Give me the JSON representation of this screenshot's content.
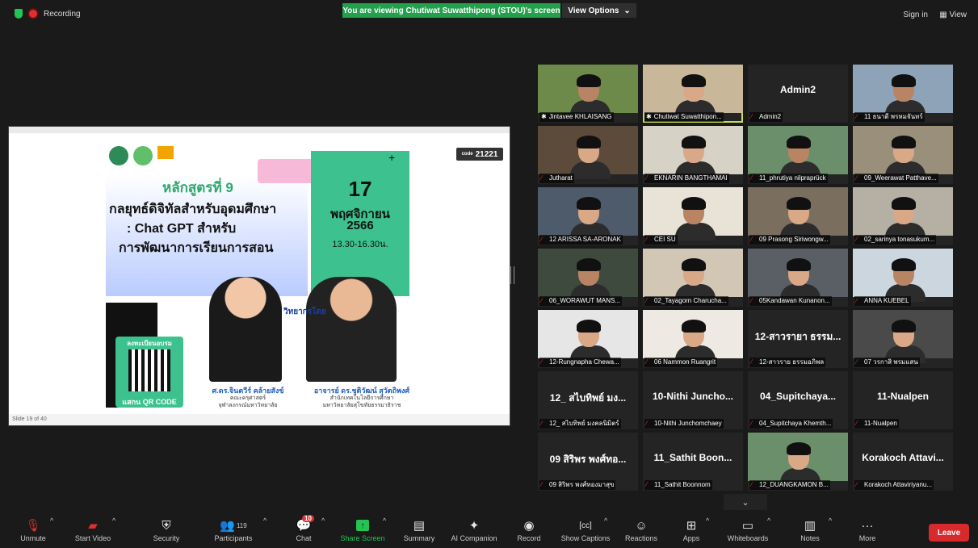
{
  "topbar": {
    "recording_label": "Recording",
    "viewing_banner": "You are viewing Chutiwat Suwatthipong (STOU)'s screen",
    "view_options": "View Options",
    "sign_in": "Sign in",
    "view": "View"
  },
  "slide": {
    "code_prefix": "code",
    "code": "21221",
    "course_title": "หลักสูตรที่ 9",
    "title_line1": "กลยุทธ์ดิจิทัลสำหรับอุดมศึกษา",
    "title_line2": ": Chat GPT สำหรับ",
    "title_line3": "การพัฒนาการเรียนการสอน",
    "day": "17",
    "month": "พฤศจิกายน",
    "year": "2566",
    "time": "13.30-16.30น.",
    "register_label": "ลงทะเบียนอบรม",
    "scan_label": "แสกน QR CODE",
    "speaker_heading": "วิทยากรโดย",
    "speaker1_name": "ศ.ดร.จินตวีร์ คล้ายสังข์",
    "speaker1_org1": "คณะครุศาสตร์",
    "speaker1_org2": "จุฬาลงกรณ์มหาวิทยาลัย",
    "speaker2_name": "อาจารย์ ดร.ชุติวัฒน์ สุวัตถิพงศ์",
    "speaker2_org1": "สำนักเทคโนโลยีการศึกษา",
    "speaker2_org2": "มหาวิทยาลัยสุโขทัยธรรมาธิราช",
    "slide_counter": "Slide 19 of 40"
  },
  "participants": [
    {
      "label": "Jintavee KHLAISANG",
      "big": "",
      "muted": false,
      "pinned": true,
      "video": true
    },
    {
      "label": "Chutiwat Suwatthipon...",
      "big": "",
      "muted": false,
      "pinned": true,
      "video": true,
      "active": true
    },
    {
      "label": "Admin2",
      "big": "Admin2",
      "muted": true,
      "video": false
    },
    {
      "label": "11 ธนาดี พรหมจันทร์",
      "big": "",
      "muted": true,
      "video": true
    },
    {
      "label": "Jutharat",
      "big": "",
      "muted": true,
      "video": true
    },
    {
      "label": "EKNARIN BANGTHAMAI",
      "big": "",
      "muted": true,
      "video": true
    },
    {
      "label": "11_phrutiya nilpraprück",
      "big": "",
      "muted": true,
      "video": true
    },
    {
      "label": "09_Weerawat Patthave...",
      "big": "",
      "muted": true,
      "video": true
    },
    {
      "label": "12 ARISSA SA-ARONAK",
      "big": "",
      "muted": true,
      "video": true
    },
    {
      "label": "CEI SU",
      "big": "",
      "muted": true,
      "video": true
    },
    {
      "label": "09 Prasong Siriwongw...",
      "big": "",
      "muted": true,
      "video": true
    },
    {
      "label": "02_sarinya tonasukum...",
      "big": "",
      "muted": true,
      "video": true
    },
    {
      "label": "06_WORAWUT MANS...",
      "big": "",
      "muted": true,
      "video": true
    },
    {
      "label": "02_Tayagorn Charucha...",
      "big": "",
      "muted": true,
      "video": true
    },
    {
      "label": "05Kandawan Kunanon...",
      "big": "",
      "muted": true,
      "video": true
    },
    {
      "label": "ANNA KUEBEL",
      "big": "",
      "muted": true,
      "video": true
    },
    {
      "label": "12-Rungnapha Chewa...",
      "big": "",
      "muted": true,
      "video": true
    },
    {
      "label": "06 Nammon Ruangrit",
      "big": "",
      "muted": true,
      "video": true
    },
    {
      "label": "12-สาวราย ธรรมอภิพล",
      "big": "12-สาวรายา ธรรม...",
      "muted": true,
      "video": false
    },
    {
      "label": "07 วรกาสิ พรมแสน",
      "big": "",
      "muted": true,
      "video": true
    },
    {
      "label": "12_ สไบทิพย์ มงคลนิมิตร์",
      "big": "12_ สไบทิพย์ มง...",
      "muted": true,
      "video": false
    },
    {
      "label": "10-Nithi Junchomchaey",
      "big": "10-Nithi Juncho...",
      "muted": true,
      "video": false
    },
    {
      "label": "04_Supitchaya Khemth...",
      "big": "04_Supitchaya...",
      "muted": true,
      "video": false
    },
    {
      "label": "11-Nualpen",
      "big": "11-Nualpen",
      "muted": true,
      "video": false
    },
    {
      "label": "09 สิริพร พงศ์ทองมาสุข",
      "big": "09 สิริพร พงศ์ทอ...",
      "muted": true,
      "video": false
    },
    {
      "label": "11_Sathit Boonnom",
      "big": "11_Sathit Boon...",
      "muted": true,
      "video": false
    },
    {
      "label": "12_DUANGKAMON B...",
      "big": "",
      "muted": true,
      "video": true
    },
    {
      "label": "Korakoch Attaviriyanu...",
      "big": "Korakoch Attavi...",
      "muted": true,
      "video": false
    }
  ],
  "toolbar": {
    "unmute": "Unmute",
    "start_video": "Start Video",
    "security": "Security",
    "participants": "Participants",
    "participants_count": "119",
    "chat": "Chat",
    "chat_badge": "10",
    "share_screen": "Share Screen",
    "summary": "Summary",
    "ai_companion": "AI Companion",
    "record": "Record",
    "show_captions": "Show Captions",
    "reactions": "Reactions",
    "apps": "Apps",
    "whiteboards": "Whiteboards",
    "notes": "Notes",
    "more": "More",
    "leave": "Leave"
  },
  "colors": {
    "accent_green": "#23c552",
    "leave_red": "#d8292c",
    "active_outline": "#c5e04b"
  }
}
